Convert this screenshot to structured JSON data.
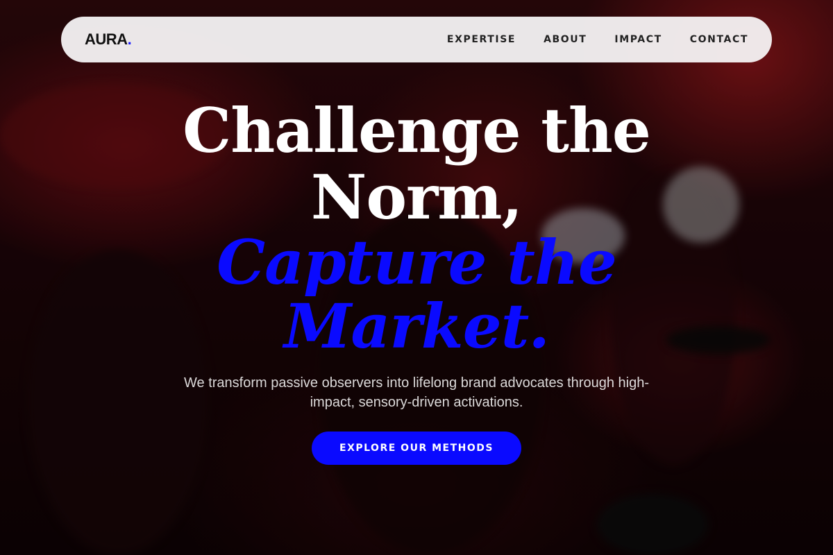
{
  "brand": {
    "name": "AURA",
    "dot": ".",
    "accent_color": "#0a0aff"
  },
  "nav": {
    "links": [
      {
        "label": "EXPERTISE"
      },
      {
        "label": "ABOUT"
      },
      {
        "label": "IMPACT"
      },
      {
        "label": "CONTACT"
      }
    ]
  },
  "hero": {
    "headline_line1": "Challenge the",
    "headline_line2": "Norm,",
    "accent_line1": "Capture the",
    "accent_line2": "Market.",
    "subtext": "We transform passive observers into lifelong brand advocates through high-impact, sensory-driven activations.",
    "cta_label": "EXPLORE OUR METHODS"
  }
}
